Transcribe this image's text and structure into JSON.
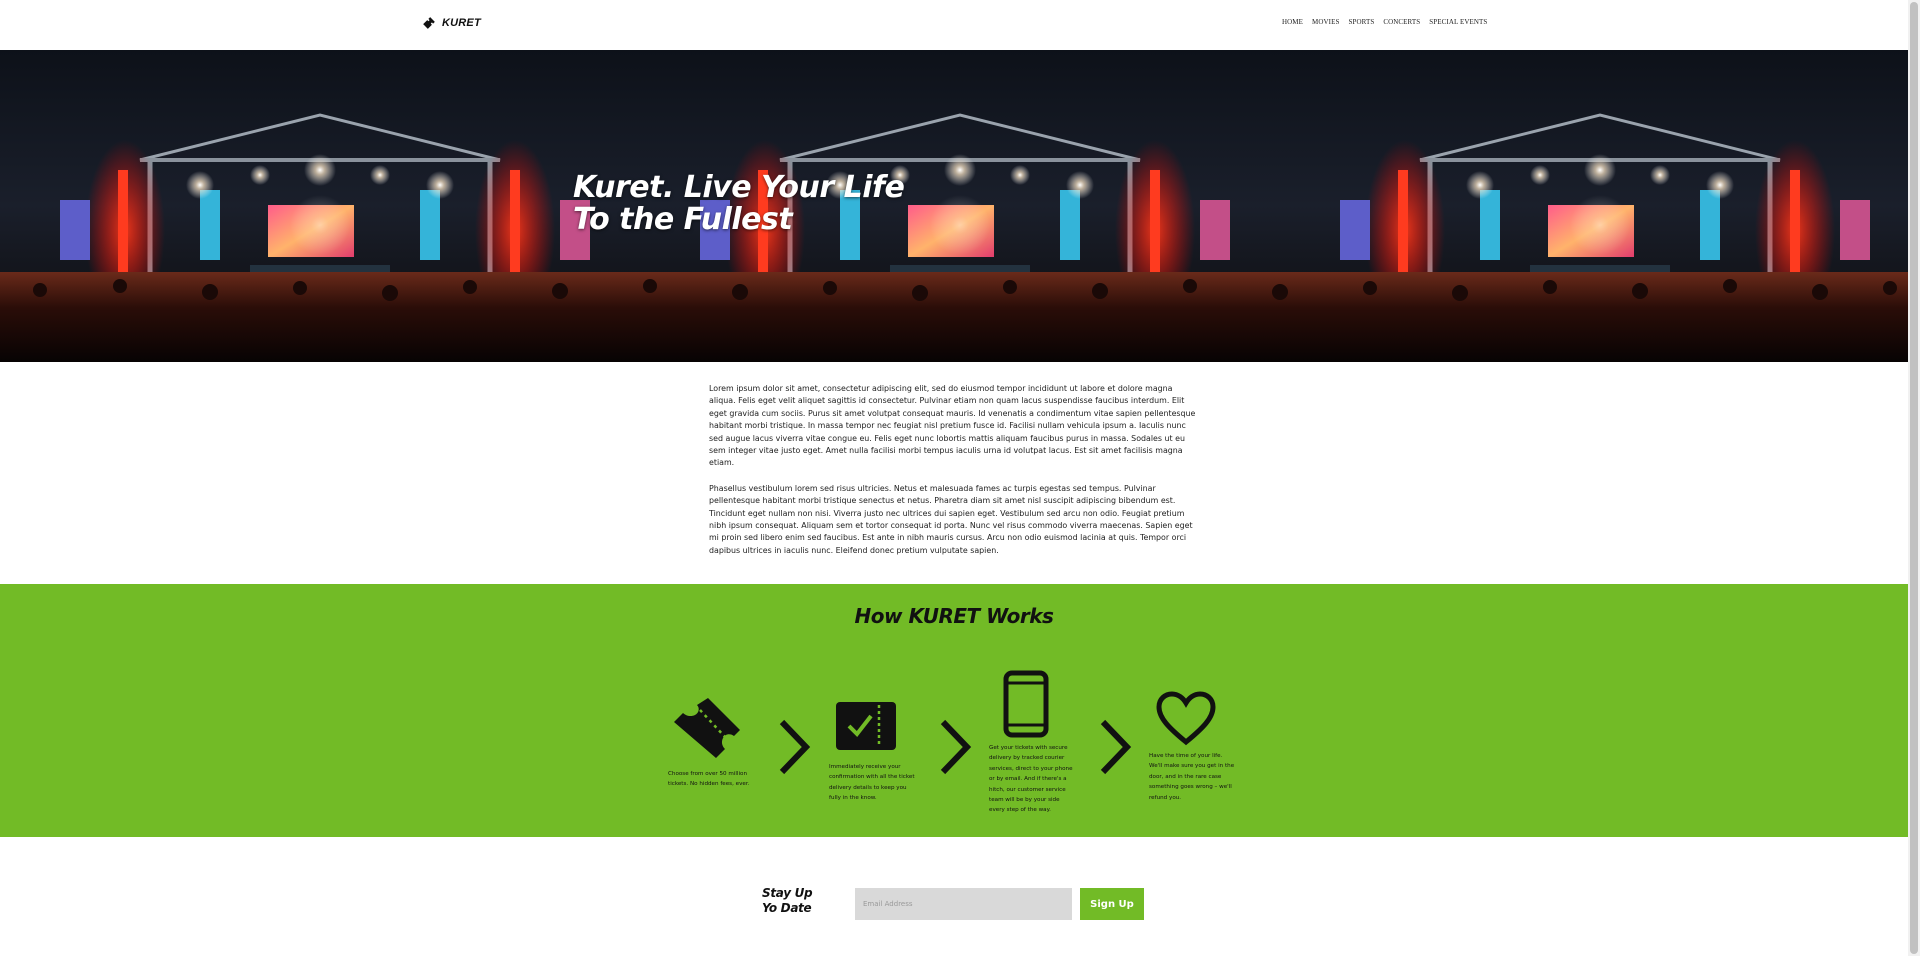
{
  "header": {
    "logo_text": "KURET",
    "nav": [
      "HOME",
      "MOVIES",
      "SPORTS",
      "CONCERTS",
      "SPECIAL EVENTS"
    ]
  },
  "hero": {
    "title_line1": "Kuret. Live Your Life",
    "title_line2": "To the Fullest"
  },
  "intro": {
    "paragraphs": [
      "Lorem ipsum dolor sit amet, consectetur adipiscing elit, sed do eiusmod tempor incididunt ut labore et dolore magna aliqua. Felis eget velit aliquet sagittis id consectetur. Pulvinar etiam non quam lacus suspendisse faucibus interdum. Elit eget gravida cum sociis. Purus sit amet volutpat consequat mauris. Id venenatis a condimentum vitae sapien pellentesque habitant morbi tristique. In massa tempor nec feugiat nisl pretium fusce id. Facilisi nullam vehicula ipsum a. Iaculis nunc sed augue lacus viverra vitae congue eu. Felis eget nunc lobortis mattis aliquam faucibus purus in massa. Sodales ut eu sem integer vitae justo eget. Amet nulla facilisi morbi tempus iaculis urna id volutpat lacus. Est sit amet facilisis magna etiam.",
      "Phasellus vestibulum lorem sed risus ultricies. Netus et malesuada fames ac turpis egestas sed tempus. Pulvinar pellentesque habitant morbi tristique senectus et netus. Pharetra diam sit amet nisl suscipit adipiscing bibendum est. Tincidunt eget nullam non nisi. Viverra justo nec ultrices dui sapien eget. Vestibulum sed arcu non odio. Feugiat pretium nibh ipsum consequat. Aliquam sem et tortor consequat id porta. Nunc vel risus commodo viverra maecenas. Sapien eget mi proin sed libero enim sed faucibus. Est ante in nibh mauris cursus. Arcu non odio euismod lacinia at quis. Tempor orci dapibus ultrices in iaculis nunc. Eleifend donec pretium vulputate sapien."
    ]
  },
  "how": {
    "title": "How KURET Works",
    "steps": [
      {
        "icon": "ticket-icon",
        "text": "Choose from over 50 million tickets. No hidden fees, ever."
      },
      {
        "icon": "ticket-check-icon",
        "text": "Immediately receive your confirmation with all the ticket delivery details to keep you fully in the know."
      },
      {
        "icon": "phone-icon",
        "text": "Get your tickets with secure delivery by tracked courier services, direct to your phone or by email. And if there's a hitch, our customer service team will be by your side every step of the way."
      },
      {
        "icon": "heart-icon",
        "text": "Have the time of your life. We'll make sure you get in the door, and in the rare case something goes wrong – we'll refund you."
      }
    ]
  },
  "signup": {
    "heading_line1": "Stay Up",
    "heading_line2": "Yo Date",
    "email_placeholder": "Email Address",
    "button_label": "Sign Up"
  },
  "colors": {
    "accent_green": "#72bb26",
    "header_bg": "#ffffff",
    "input_bg": "#d9d9d9"
  }
}
